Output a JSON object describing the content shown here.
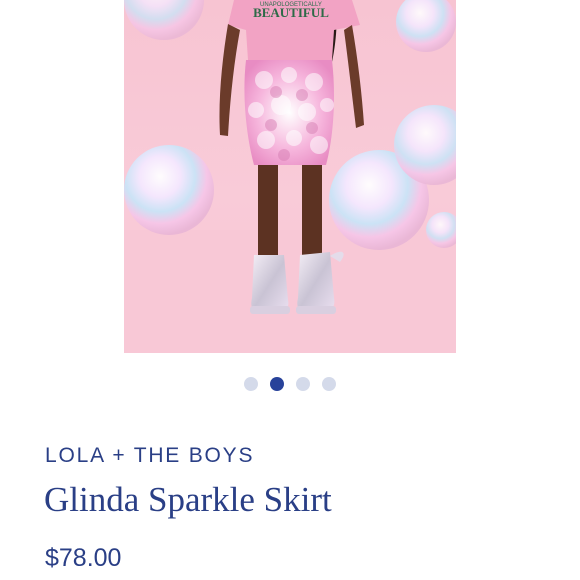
{
  "product": {
    "image_alt": "Model wearing pink sequin skirt with silver boots among iridescent balloons",
    "shirt_text_top": "UNAPOLOGETICALLY",
    "shirt_text_main": "BEAUTIFUL",
    "brand": "LOLA + THE BOYS",
    "title": "Glinda Sparkle Skirt",
    "price": "$78.00"
  },
  "carousel": {
    "total": 4,
    "active_index": 1
  },
  "colors": {
    "accent": "#28429a",
    "dot_inactive": "#d4daea",
    "text": "#2a3f86"
  }
}
